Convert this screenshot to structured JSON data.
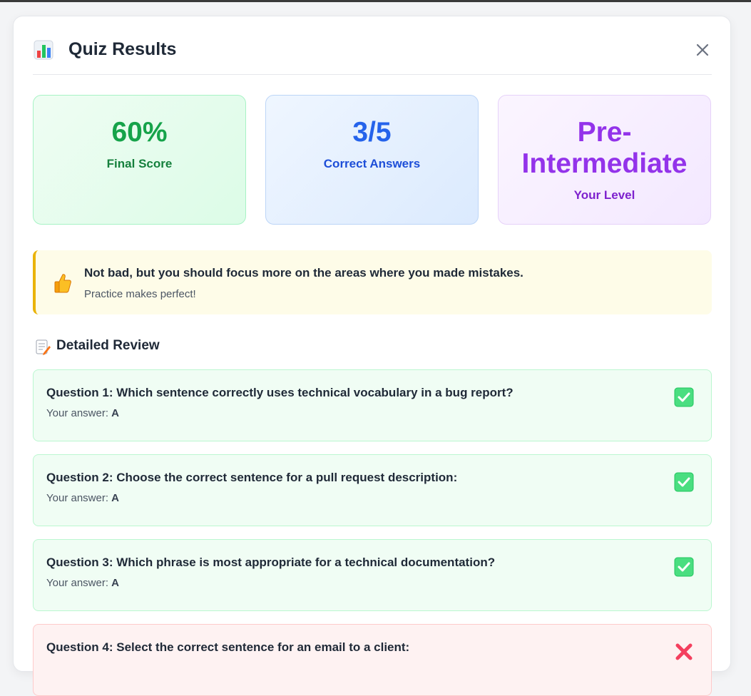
{
  "header": {
    "title": "Quiz Results",
    "icon": "bar-chart-icon",
    "close_icon": "close-icon"
  },
  "stats": [
    {
      "value": "60%",
      "label": "Final Score",
      "color": "#16a34a"
    },
    {
      "value": "3/5",
      "label": "Correct Answers",
      "color": "#2563eb"
    },
    {
      "value": "Pre-Intermediate",
      "label": "Your Level",
      "color": "#9333ea"
    }
  ],
  "feedback": {
    "icon": "thumbs-up-icon",
    "message": "Not bad, but you should focus more on the areas where you made mistakes.",
    "sub": "Practice makes perfect!"
  },
  "review": {
    "icon": "memo-icon",
    "title": "Detailed Review",
    "answer_prefix": "Your answer:",
    "questions": [
      {
        "text": "Question 1: Which sentence correctly uses technical vocabulary in a bug report?",
        "answer": "A",
        "correct": true
      },
      {
        "text": "Question 2: Choose the correct sentence for a pull request description:",
        "answer": "A",
        "correct": true
      },
      {
        "text": "Question 3: Which phrase is most appropriate for a technical documentation?",
        "answer": "A",
        "correct": true
      },
      {
        "text": "Question 4: Select the correct sentence for an email to a client:",
        "answer": "",
        "correct": false
      }
    ]
  },
  "colors": {
    "correct": "#22c55e",
    "incorrect": "#f43f5e",
    "feedback_border": "#eab308"
  }
}
